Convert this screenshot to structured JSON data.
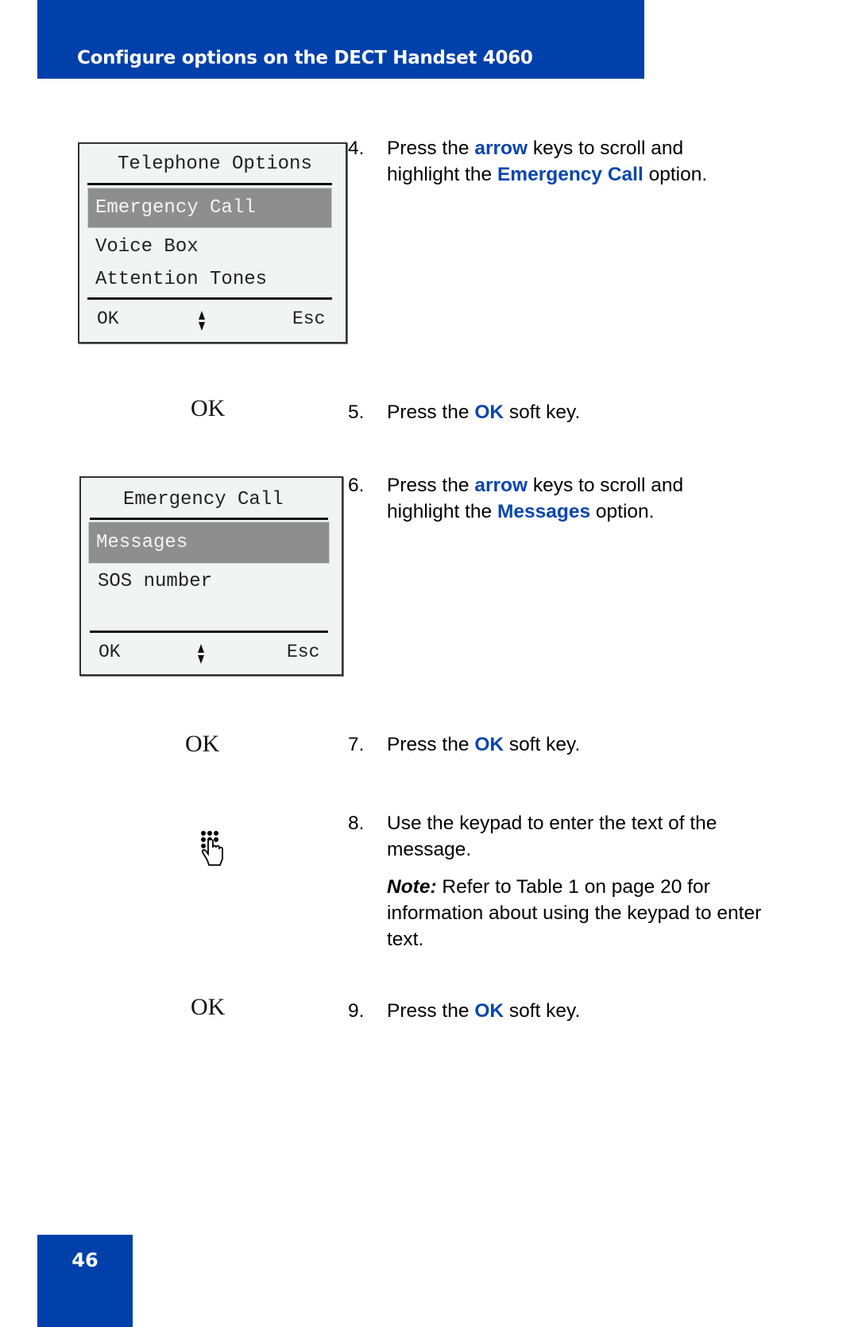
{
  "header": {
    "title": "Configure options on the DECT Handset 4060"
  },
  "screens": [
    {
      "title": "Telephone Options",
      "items": [
        {
          "label": "Emergency Call",
          "selected": true
        },
        {
          "label": "Voice Box",
          "selected": false
        },
        {
          "label": "Attention Tones",
          "selected": false
        }
      ],
      "softkeys": {
        "left": "OK",
        "middle_icon": "up-down-arrow-icon",
        "right": "Esc"
      }
    },
    {
      "title": "Emergency Call",
      "items": [
        {
          "label": "Messages",
          "selected": true
        },
        {
          "label": "SOS number",
          "selected": false
        }
      ],
      "softkeys": {
        "left": "OK",
        "middle_icon": "up-down-arrow-icon",
        "right": "Esc"
      }
    }
  ],
  "key_labels": {
    "ok5": "OK",
    "ok7": "OK",
    "ok9": "OK",
    "keypad_icon": "keypad-hand-icon"
  },
  "steps": [
    {
      "num": "4.",
      "parts": [
        "Press the ",
        "arrow",
        " keys to scroll and highlight the ",
        "Emergency Call",
        " option."
      ]
    },
    {
      "num": "5.",
      "parts": [
        "Press the ",
        "OK",
        " soft key."
      ]
    },
    {
      "num": "6.",
      "parts": [
        "Press the ",
        "arrow",
        " keys to scroll and highlight the ",
        "Messages",
        " option."
      ]
    },
    {
      "num": "7.",
      "parts": [
        "Press the ",
        "OK",
        " soft key."
      ]
    },
    {
      "num": "8.",
      "text": "Use the keypad to enter the text of the message."
    },
    {
      "num": "9.",
      "parts": [
        "Press the ",
        "OK",
        " soft key."
      ]
    }
  ],
  "note": {
    "label": "Note:",
    "text": " Refer to Table 1 on page 20 for information about using the keypad to enter text."
  },
  "footer": {
    "page_number": "46"
  },
  "colors": {
    "brand_blue": "#0040ab",
    "highlight_text": "#0a46ad",
    "selected_row": "#8e8e8e"
  }
}
